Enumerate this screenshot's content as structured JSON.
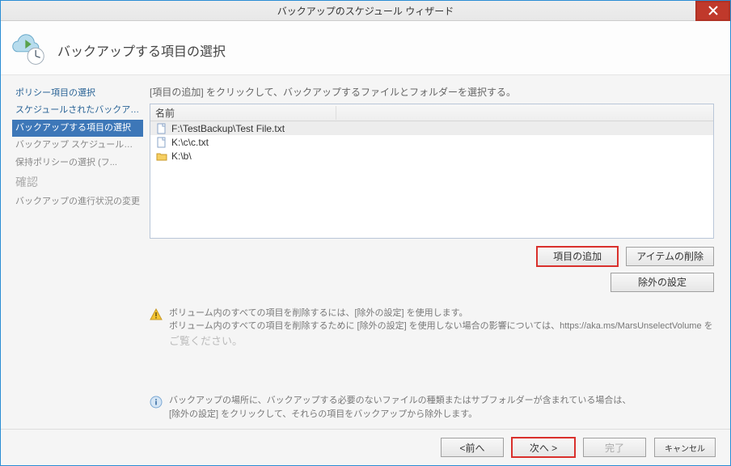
{
  "window": {
    "title": "バックアップのスケジュール ウィザード"
  },
  "header": {
    "title": "バックアップする項目の選択"
  },
  "sidebar": {
    "steps": [
      {
        "label": "ポリシー項目の選択",
        "state": "done"
      },
      {
        "label": "スケジュールされたバックアップの...",
        "state": "done"
      },
      {
        "label": "バックアップする項目の選択",
        "state": "active"
      },
      {
        "label": "バックアップ スケジュールの選択...",
        "state": ""
      },
      {
        "label": "保持ポリシーの選択 (フ...",
        "state": ""
      },
      {
        "label": "確認",
        "state": "big"
      },
      {
        "label": "バックアップの進行状況の変更",
        "state": ""
      }
    ]
  },
  "main": {
    "instruction": "[項目の追加] をクリックして、バックアップするファイルとフォルダーを選択する。",
    "list": {
      "header": "名前",
      "items": [
        {
          "type": "file",
          "path": "F:\\TestBackup\\Test File.txt",
          "selected": true
        },
        {
          "type": "file",
          "path": "K:\\c\\c.txt",
          "selected": false
        },
        {
          "type": "folder",
          "path": "K:\\b\\",
          "selected": false
        }
      ]
    },
    "buttons": {
      "add": "項目の追加",
      "remove": "アイテムの削除",
      "exclusions": "除外の設定"
    },
    "warning": {
      "line1": "ボリューム内のすべての項目を削除するには、[除外の設定] を使用します。",
      "line2": "ボリューム内のすべての項目を削除するために [除外の設定] を使用しない場合の影響については、https://aka.ms/MarsUnselectVolume を",
      "line3": "ご覧ください。"
    },
    "info": {
      "line1": "バックアップの場所に、バックアップする必要のないファイルの種類またはサブフォルダーが含まれている場合は、",
      "line2": "[除外の設定] をクリックして、それらの項目をバックアップから除外します。"
    }
  },
  "footer": {
    "back": "<前へ",
    "next": "次へ >",
    "finish": "完了",
    "cancel": "キャンセル"
  }
}
